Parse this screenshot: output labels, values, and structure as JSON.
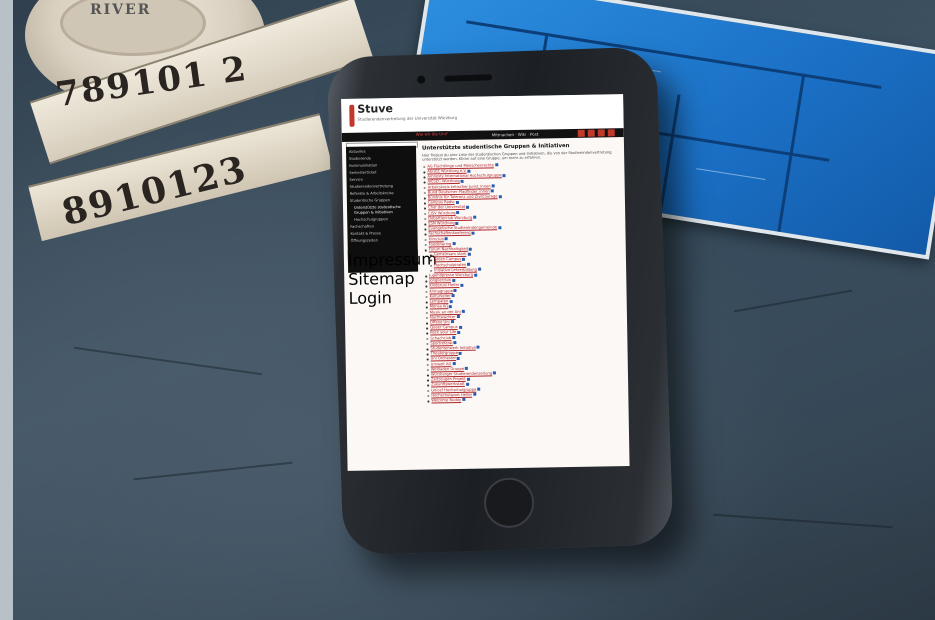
{
  "scene": {
    "tape_numbers_top": "789101 2",
    "tape_numbers_bottom": "8910123",
    "tape_brand": "RIVER"
  },
  "site": {
    "logo": "Stuve",
    "subtitle": "Studierendenvertretung der Universität Würzburg",
    "nav_tag": "Wie wir die Uni?",
    "nav_right": "Mitmachen · Wiki · Post",
    "colors": {
      "accent": "#c0392b",
      "link": "#b0262b",
      "nav_bg": "#111111"
    }
  },
  "sidebar": {
    "items": [
      "Aktuelles",
      "Studierende",
      "Kommunikation",
      "Semesterticket",
      "Service",
      "Studierendenvertretung",
      "Referate & Arbeitskreise",
      "Studentische Gruppen",
      "Unterstützte studentische",
      "Gruppen & Initiativen",
      "Hochschulgruppen",
      "Fachschaften",
      "Kontakt & Presse",
      "Öffnungszeiten"
    ],
    "bottom_items": [
      "Impressum",
      "Sitemap",
      "Login"
    ]
  },
  "main": {
    "title": "Unterstützte studentische Gruppen & Initiativen",
    "intro": "Hier findest du eine Liste der studentischen Gruppen und Initiativen, die von der Studierendenvertretung unterstützt werden. Klicke auf eine Gruppe, um mehr zu erfahren.",
    "links": [
      "AG Flüchtlinge und Menschenrechte",
      "AEGEE Würzburg e.V.",
      "Amnesty International Hochschulgruppe",
      "AIESEC Würzburg",
      "Arbeitskreis kritischer Jurist_innen",
      "Bund Deutscher Pfadfinder_innen",
      "Bündnis für Toleranz und Zivilcourage",
      "Campus Radio",
      "Chor der Universität",
      "CISV Würzburg",
      "Debattierclub Würzburg",
      "ESN Würzburg",
      "Evangelische Studierendengemeinde",
      "Fachschaftenkonferenz",
      "Filmclub",
      "Foodsharing",
      "Forum Nachhaltigkeit",
      "Gemeinsam stark",
      "Green Campus",
      "Hochschulpiraten",
      "Initiative Lehrerbildung",
      "Jugendpresse Würzburg",
      "Jonglierclub",
      "Kinderuni Helfer",
      "Klimagruppe",
      "Kulturkeller",
      "Lernpaten",
      "Mensa AG",
      "Musik an der Uni",
      "Nachtwächter",
      "Offene Uni",
      "Queer Campus",
      "Rock your Life",
      "Schachclub",
      "Sportreferat",
      "Studentenwerk Initiative",
      "Theatergruppe",
      "Uni Orchester",
      "Umwelt AG",
      "Weltladen Gruppe",
      "Würzburger Studierendenzeitung",
      "Zeitzeugen Projekt",
      "Zukunftswerkstatt",
      "Unicef Hochschulgruppe",
      "Hochschulsport Helfer",
      "Welcome Buddy"
    ]
  }
}
